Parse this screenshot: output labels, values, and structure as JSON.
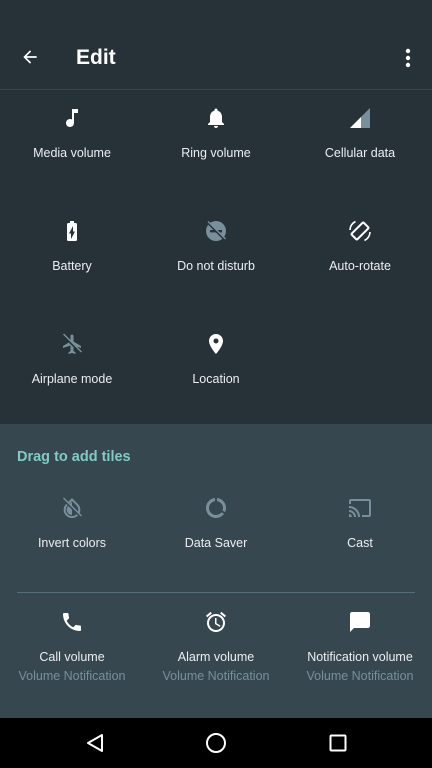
{
  "toolbar": {
    "title": "Edit"
  },
  "active_tiles": [
    {
      "label": "Media volume",
      "icon": "music-note-icon"
    },
    {
      "label": "Ring volume",
      "icon": "bell-icon"
    },
    {
      "label": "Cellular data",
      "icon": "cellular-signal-icon"
    },
    {
      "label": "Battery",
      "icon": "battery-icon"
    },
    {
      "label": "Do not disturb",
      "icon": "do-not-disturb-icon"
    },
    {
      "label": "Auto-rotate",
      "icon": "auto-rotate-icon"
    },
    {
      "label": "Airplane mode",
      "icon": "airplane-icon"
    },
    {
      "label": "Location",
      "icon": "location-pin-icon"
    }
  ],
  "available": {
    "title": "Drag to add tiles",
    "tiles": [
      {
        "label": "Invert colors",
        "icon": "invert-colors-icon"
      },
      {
        "label": "Data Saver",
        "icon": "data-saver-icon"
      },
      {
        "label": "Cast",
        "icon": "cast-icon"
      },
      {
        "label": "Call volume",
        "sub": "Volume Notification",
        "icon": "phone-icon"
      },
      {
        "label": "Alarm volume",
        "sub": "Volume Notification",
        "icon": "alarm-clock-icon"
      },
      {
        "label": "Notification volume",
        "sub": "Volume Notification",
        "icon": "chat-bubble-icon"
      }
    ]
  },
  "colors": {
    "background": "#263238",
    "panel": "#37474f",
    "accent": "#80cbc4",
    "secondary_text": "#78909c",
    "disabled_icon": "#78909c"
  }
}
